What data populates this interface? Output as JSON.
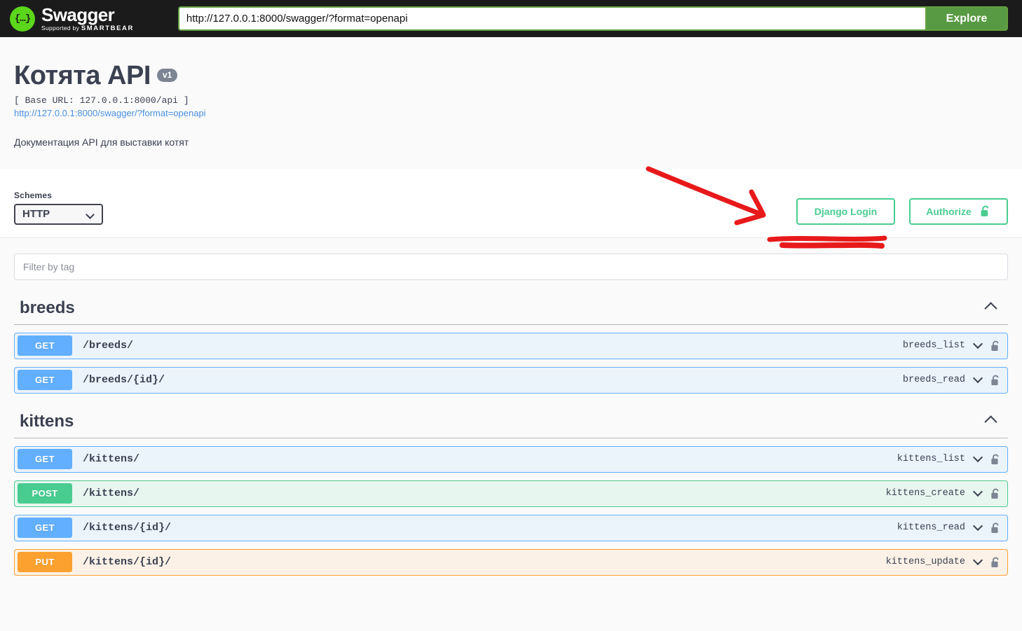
{
  "topbar": {
    "logo_title": "Swagger",
    "logo_trademark": ".",
    "logo_supported_prefix": "Supported by ",
    "logo_brand": "SMARTBEAR",
    "logo_mark_glyph": "{…}",
    "url_value": "http://127.0.0.1:8000/swagger/?format=openapi",
    "url_placeholder": "http://127.0.0.1:8000/swagger/?format=openapi",
    "explore_label": "Explore"
  },
  "info": {
    "title": "Котята API",
    "version": "v1",
    "base_url": "[ Base URL: 127.0.0.1:8000/api ]",
    "spec_link": "http://127.0.0.1:8000/swagger/?format=openapi",
    "description": "Документация API для выставки котят"
  },
  "scheme_band": {
    "schemes_label": "Schemes",
    "schemes_selected": "HTTP",
    "schemes_options": [
      "HTTP"
    ],
    "django_login_label": "Django Login",
    "authorize_label": "Authorize"
  },
  "filter": {
    "placeholder": "Filter by tag",
    "value": ""
  },
  "colors": {
    "get": "#61affe",
    "post": "#49cc90",
    "put": "#fca130",
    "authorize_green": "#49cc90",
    "explore_green": "#589a43",
    "link_blue": "#4990e2",
    "annotation_red": "#e8191b"
  },
  "tags": [
    {
      "name": "breeds",
      "collapse_icon": "chevron-up-icon",
      "operations": [
        {
          "method": "GET",
          "path": "/breeds/",
          "operation_id": "breeds_list",
          "lock": "unlocked-padlock-icon",
          "expand_icon": "chevron-down-icon"
        },
        {
          "method": "GET",
          "path": "/breeds/{id}/",
          "operation_id": "breeds_read",
          "lock": "unlocked-padlock-icon",
          "expand_icon": "chevron-down-icon"
        }
      ]
    },
    {
      "name": "kittens",
      "collapse_icon": "chevron-up-icon",
      "operations": [
        {
          "method": "GET",
          "path": "/kittens/",
          "operation_id": "kittens_list",
          "lock": "unlocked-padlock-icon",
          "expand_icon": "chevron-down-icon"
        },
        {
          "method": "POST",
          "path": "/kittens/",
          "operation_id": "kittens_create",
          "lock": "unlocked-padlock-icon",
          "expand_icon": "chevron-down-icon"
        },
        {
          "method": "GET",
          "path": "/kittens/{id}/",
          "operation_id": "kittens_read",
          "lock": "unlocked-padlock-icon",
          "expand_icon": "chevron-down-icon"
        },
        {
          "method": "PUT",
          "path": "/kittens/{id}/",
          "operation_id": "kittens_update",
          "lock": "unlocked-padlock-icon",
          "expand_icon": "chevron-down-icon"
        }
      ]
    }
  ],
  "annotation": {
    "kind": "hand-drawn-red-arrow-and-underline",
    "points_at": "Django Login"
  }
}
